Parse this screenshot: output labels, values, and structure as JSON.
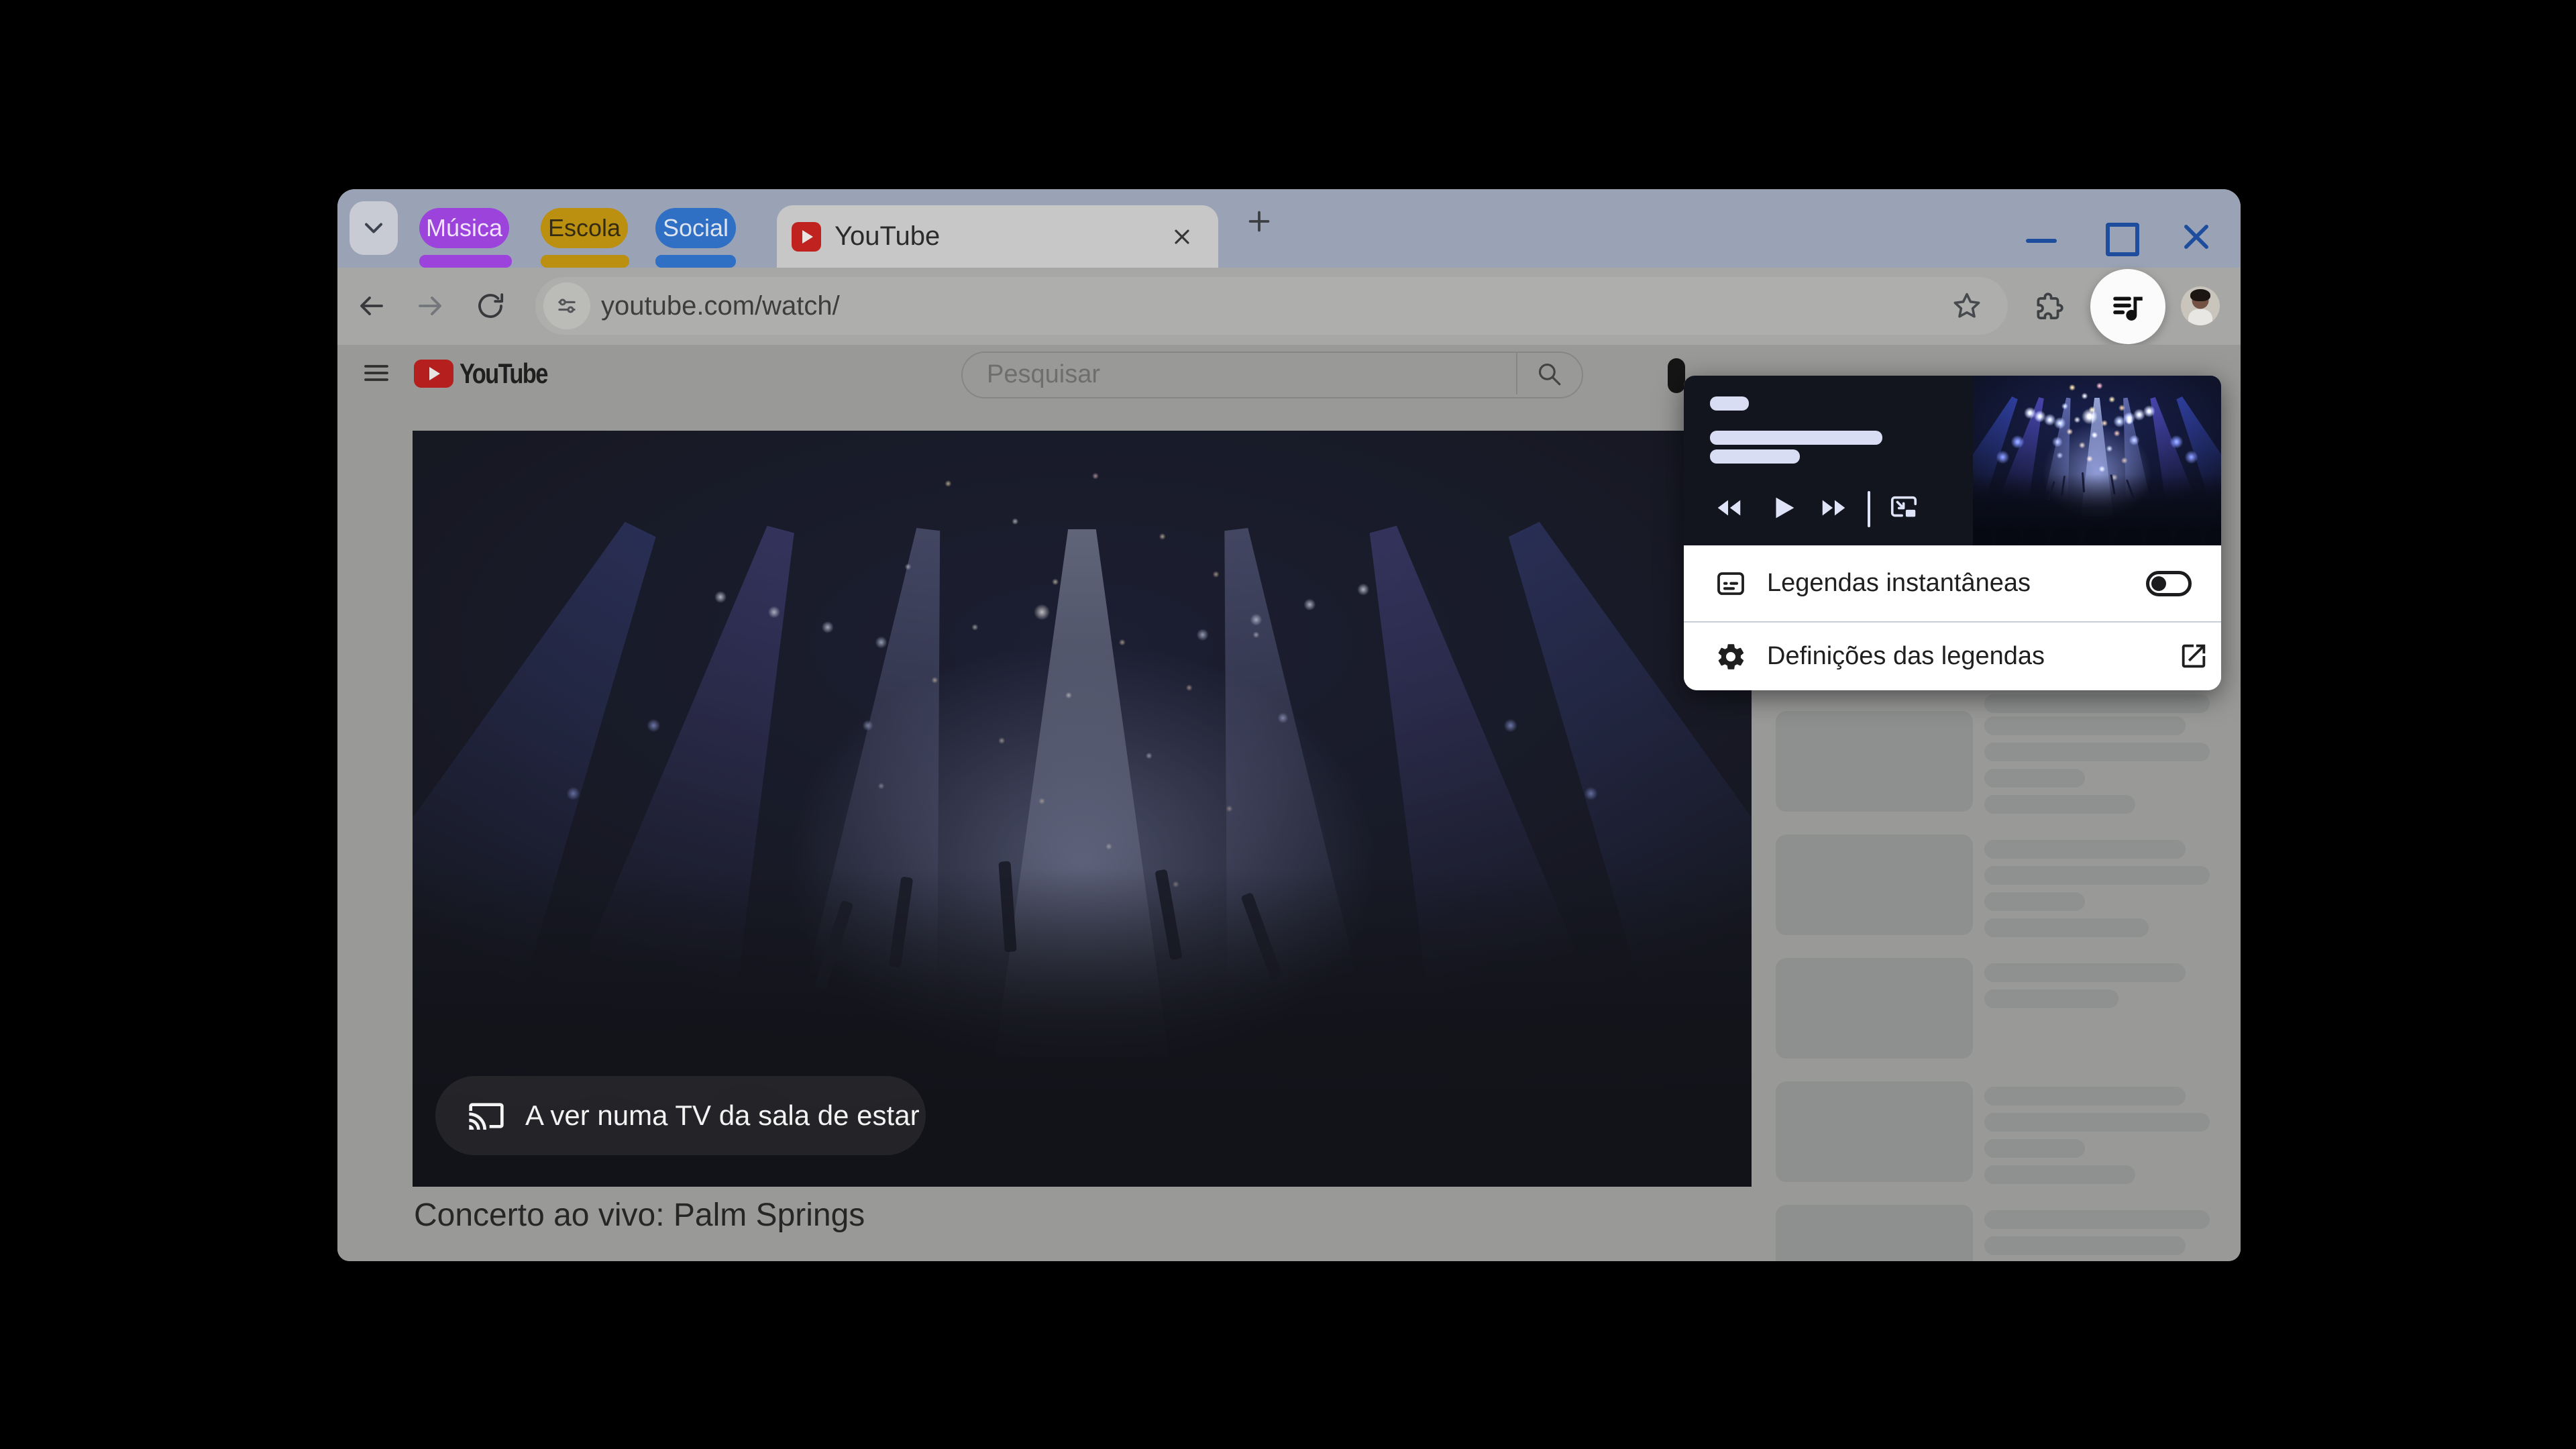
{
  "tab_strip": {
    "groups": [
      {
        "label": "Música",
        "color": "#9c43dc"
      },
      {
        "label": "Escola",
        "color": "#bb8f10"
      },
      {
        "label": "Social",
        "color": "#2f6fc4"
      }
    ],
    "active_tab_label": "YouTube"
  },
  "toolbar": {
    "url": "youtube.com/watch/"
  },
  "youtube_page": {
    "brand": "YouTube",
    "search_placeholder": "Pesquisar",
    "cast_banner": "A ver numa TV da sala de estar",
    "video_title": "Concerto ao vivo: Palm Springs"
  },
  "media_popup": {
    "rows": [
      {
        "label": "Legendas instantâneas",
        "toggle_on": false
      },
      {
        "label": "Definições das legendas"
      }
    ]
  },
  "colors": {
    "window_control_blue": "#1e4d9e",
    "tab_group_purple": "#9c43dc",
    "tab_group_yellow": "#bb8f10",
    "tab_group_blue": "#2f6fc4",
    "youtube_red": "#c0231f",
    "popup_header_bg": "#12151e",
    "popup_skeleton": "#d9ddf3"
  }
}
